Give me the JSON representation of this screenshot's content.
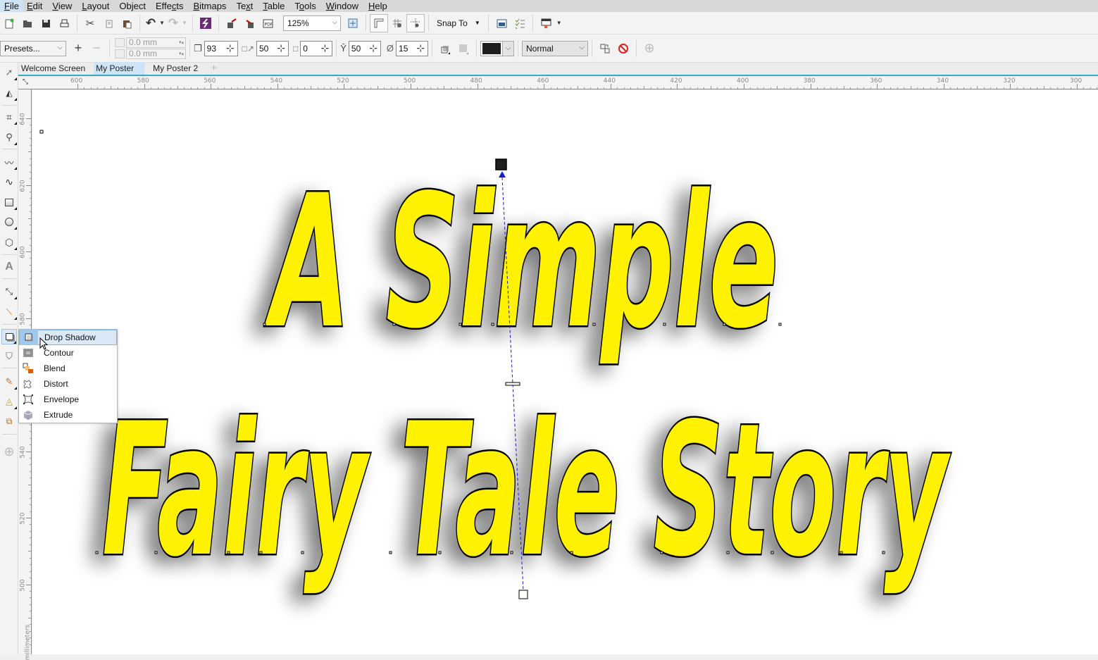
{
  "menubar": {
    "items": [
      {
        "label": "File",
        "u": "F"
      },
      {
        "label": "Edit",
        "u": "E"
      },
      {
        "label": "View",
        "u": "V"
      },
      {
        "label": "Layout",
        "u": "L"
      },
      {
        "label": "Object",
        "u": "j"
      },
      {
        "label": "Effects",
        "u": "c"
      },
      {
        "label": "Bitmaps",
        "u": "B"
      },
      {
        "label": "Text",
        "u": "x"
      },
      {
        "label": "Table",
        "u": "T"
      },
      {
        "label": "Tools",
        "u": "o"
      },
      {
        "label": "Window",
        "u": "W"
      },
      {
        "label": "Help",
        "u": "H"
      }
    ]
  },
  "standard_toolbar": {
    "zoom_level": "125%",
    "snap_to_label": "Snap To"
  },
  "property_bar": {
    "presets_label": "Presets...",
    "offset_x": "0.0 mm",
    "offset_y": "0.0 mm",
    "shadow_angle": "93",
    "shadow_stretch": "50",
    "shadow_fade": "0",
    "shadow_opacity": "50",
    "shadow_feathering": "15",
    "shadow_color": "#1e1e1e",
    "merge_mode": "Normal"
  },
  "document_tabs": [
    {
      "label": "Welcome Screen",
      "active": false
    },
    {
      "label": "My Poster",
      "active": true
    },
    {
      "label": "My Poster 2",
      "active": false
    }
  ],
  "rulers": {
    "horizontal_labels": [
      "600",
      "580",
      "560",
      "540",
      "520",
      "500",
      "480",
      "460",
      "440",
      "420",
      "400",
      "380",
      "360",
      "340",
      "320",
      "300"
    ],
    "vertical_labels": [
      "640",
      "620",
      "600",
      "580",
      "560",
      "540",
      "520",
      "500"
    ],
    "unit_label": "millimeters"
  },
  "canvas": {
    "line1": "A Simple",
    "line2": "Fairy Tale Story",
    "text_fill": "#fff200",
    "text_outline": "#000000",
    "shadow_handle_color": "#1e1e1e",
    "vector_color": "#1a1ad0"
  },
  "effects_flyout": {
    "items": [
      {
        "label": "Drop Shadow",
        "icon": "drop-shadow-icon",
        "highlighted": true
      },
      {
        "label": "Contour",
        "icon": "contour-icon",
        "highlighted": false
      },
      {
        "label": "Blend",
        "icon": "blend-icon",
        "highlighted": false
      },
      {
        "label": "Distort",
        "icon": "distort-icon",
        "highlighted": false
      },
      {
        "label": "Envelope",
        "icon": "envelope-icon",
        "highlighted": false
      },
      {
        "label": "Extrude",
        "icon": "extrude-icon",
        "highlighted": false
      }
    ]
  }
}
